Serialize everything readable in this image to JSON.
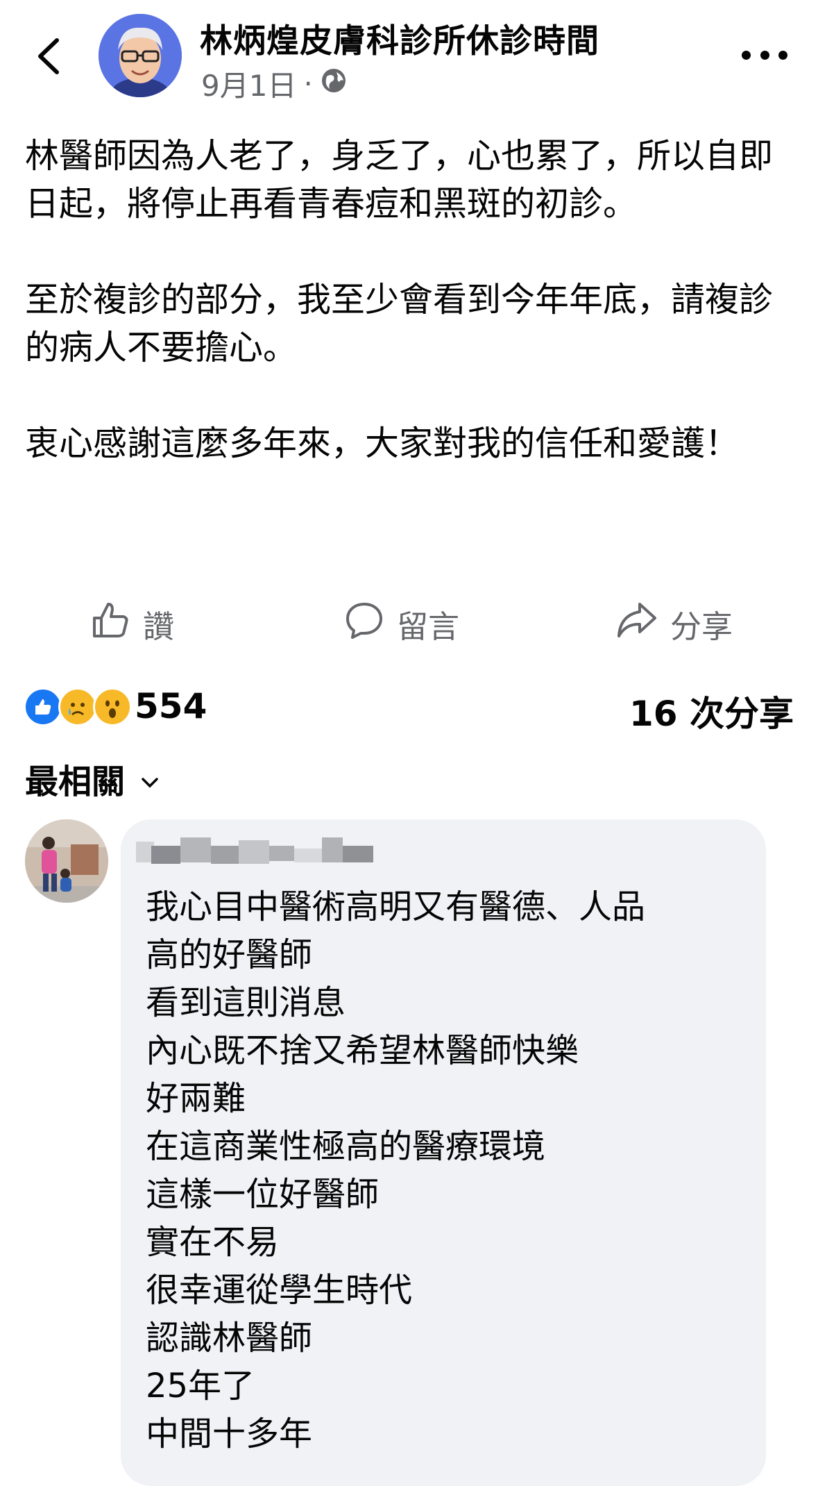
{
  "header": {
    "title": "林炳煌皮膚科診所休診時間",
    "date": "9月1日",
    "separator": "·"
  },
  "post": {
    "paragraphs": [
      "林醫師因為人老了，身乏了，心也累了，所以自即日起，將停止再看青春痘和黑斑的初診。",
      "至於複診的部分，我至少會看到今年年底，請複診的病人不要擔心。",
      "衷心感謝這麼多年來，大家對我的信任和愛護！"
    ]
  },
  "actions": {
    "like": "讚",
    "comment": "留言",
    "share": "分享"
  },
  "stats": {
    "reaction_count": "554",
    "share_count": "16 次分享"
  },
  "comments_sort": "最相關",
  "comment": {
    "text": "我心目中醫術高明又有醫德、人品\n高的好醫師\n看到這則消息\n內心既不捨又希望林醫師快樂\n好兩難\n在這商業性極高的醫療環境\n這樣一位好醫師\n實在不易\n很幸運從學生時代\n認識林醫師\n25年了\n中間十多年"
  },
  "colors": {
    "like_blue": "#1877f2",
    "secondary_text": "#65676b",
    "bubble": "#f0f2f5",
    "emoji_yellow": "#f7b928"
  }
}
